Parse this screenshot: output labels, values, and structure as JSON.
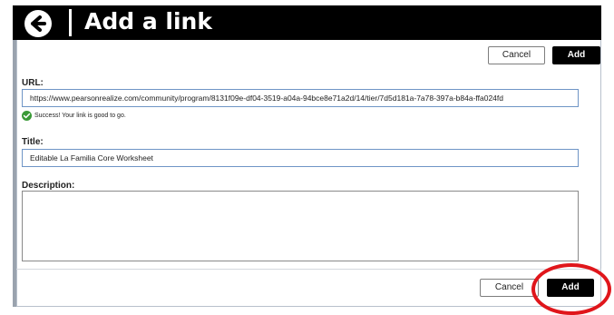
{
  "header": {
    "title": "Add a link"
  },
  "top_actions": {
    "cancel_label": "Cancel",
    "add_label": "Add"
  },
  "form": {
    "url_label": "URL:",
    "url_value": "https://www.pearsonrealize.com/community/program/8131f09e-df04-3519-a04a-94bce8e71a2d/14/tier/7d5d181a-7a78-397a-b84a-ffa024fd",
    "success_message": "Success! Your link is good to go.",
    "title_label": "Title:",
    "title_value": "Editable La Familia Core Worksheet",
    "description_label": "Description:",
    "description_value": ""
  },
  "bottom_actions": {
    "cancel_label": "Cancel",
    "add_label": "Add"
  },
  "colors": {
    "header_bg": "#000000",
    "accent_border": "#6f95c6",
    "success": "#3a9a37",
    "highlight": "#e0161b"
  },
  "icons": {
    "back": "arrow-left-circle-icon",
    "success": "check-circle-icon"
  }
}
